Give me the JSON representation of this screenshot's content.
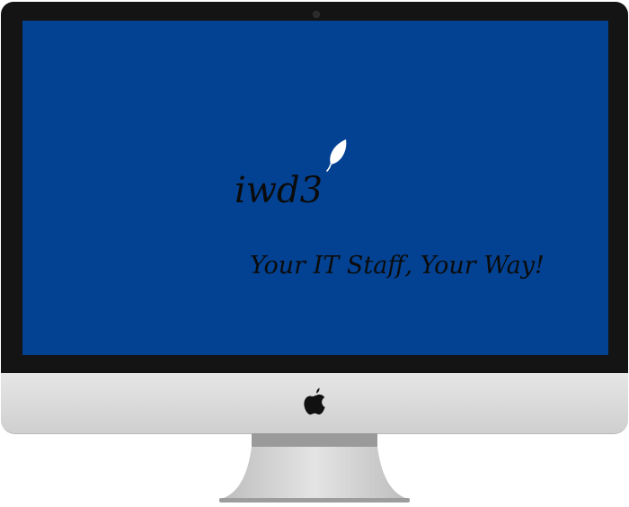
{
  "screen": {
    "logo_text": "iwd3",
    "tagline": "Your IT Staff, Your Way!",
    "background_color": "#034292",
    "text_color": "#0b0b0b"
  },
  "icons": {
    "logo_mark": "leaf-icon",
    "hardware_badge": "apple-icon"
  },
  "device": {
    "type": "desktop monitor",
    "bezel_color": "#141414",
    "chin_color": "#dcdcdc"
  }
}
